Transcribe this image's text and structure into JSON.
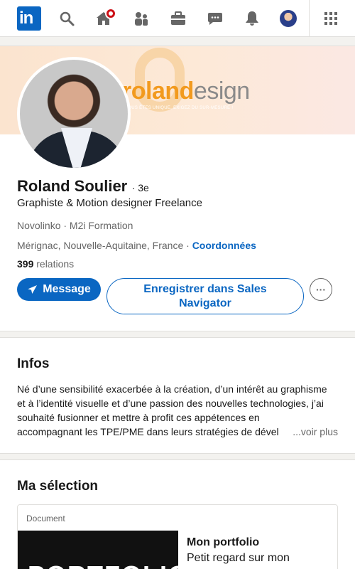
{
  "nav": {
    "logo": "in",
    "icons": [
      "search-icon",
      "home-icon",
      "network-icon",
      "jobs-icon",
      "messaging-icon",
      "notifications-icon",
      "me-avatar",
      "apps-grid-icon"
    ]
  },
  "banner": {
    "brand_part1": "roland",
    "brand_part2": "esign",
    "tagline": "VOUS ÊTES UNIQUE, EXIGEZ DU SUR-MESURE !"
  },
  "profile": {
    "name": "Roland Soulier",
    "degree": "· 3e",
    "headline": "Graphiste & Motion designer Freelance",
    "companies": "Novolinko · M2i Formation",
    "location": "Mérignac, Nouvelle-Aquitaine, France",
    "location_sep": " · ",
    "contact_link": "Coordonnées",
    "connections_count": "399",
    "connections_label": " relations",
    "message_button": "Message",
    "sales_nav_button": "Enregistrer dans Sales Navigator",
    "more_button": "···"
  },
  "infos": {
    "title": "Infos",
    "lines": [
      "Né d’une sensibilité exacerbée à la création, d’un intérêt au graphisme",
      "et à l’identité visuelle et d’une passion des nouvelles technologies, j’ai",
      "souhaité fusionner et mettre à profit ces appétences en",
      "accompagnant les TPE/PME dans leurs stratégies de dével"
    ],
    "see_more": "...voir plus"
  },
  "selection": {
    "title": "Ma sélection",
    "doc_label": "Document",
    "thumb_text": "PORTFOLIO",
    "doc_title": "Mon portfolio",
    "doc_desc": "Petit regard sur mon"
  },
  "colors": {
    "brand_blue": "#0a66c2",
    "notification_red": "#cc1016"
  }
}
